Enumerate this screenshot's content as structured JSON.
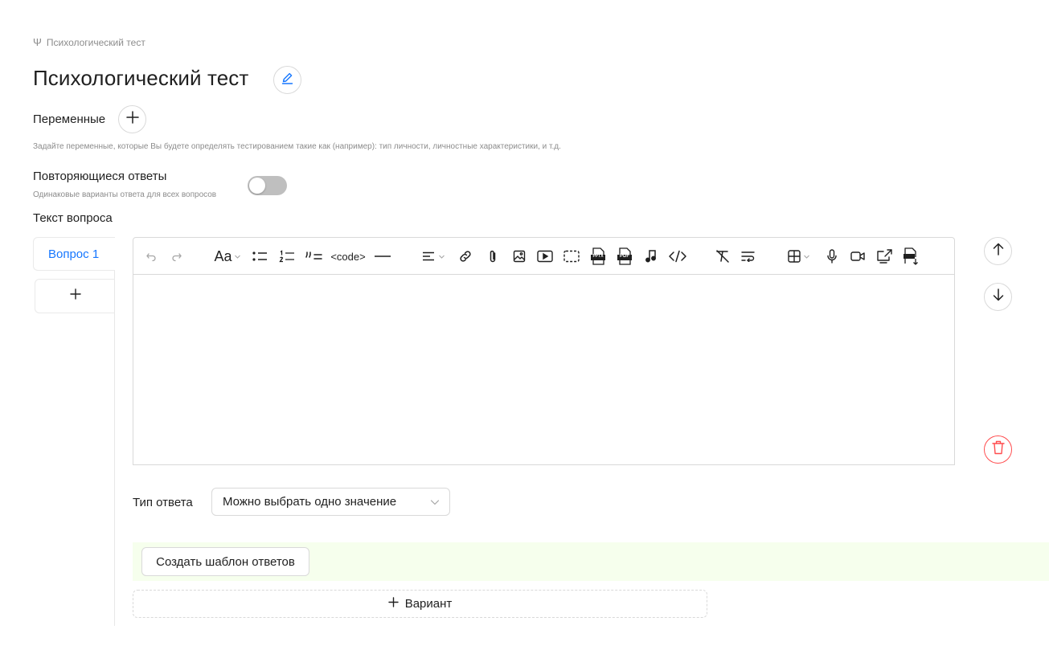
{
  "breadcrumb": {
    "icon": "psi-icon",
    "symbol": "Ψ",
    "label": "Психологический тест"
  },
  "title": "Психологический тест",
  "variables": {
    "label": "Переменные",
    "hint": "Задайте переменные, которые Вы будете определять тестированием такие как (например): тип личности, личностные характеристики, и т.д."
  },
  "repeat_answers": {
    "label": "Повторяющиеся ответы",
    "hint": "Одинаковые варианты ответа для всех вопросов",
    "enabled": false
  },
  "question_text_label": "Текст вопроса",
  "questions": [
    {
      "label": "Вопрос 1",
      "active": true
    }
  ],
  "toolbar": {
    "font_size_label": "Aa",
    "code_label": "<code>",
    "pptx_label": "PPTX",
    "pdf_label": "PDF"
  },
  "answer_type": {
    "label": "Тип ответа",
    "selected": "Можно выбрать одно значение"
  },
  "template_button": "Создать шаблон ответов",
  "variant_button": "Вариант",
  "colors": {
    "accent": "#1677ff",
    "danger": "#ff4d4f",
    "template_bg": "#f6ffed",
    "toggle_off": "#bfbfbf"
  }
}
